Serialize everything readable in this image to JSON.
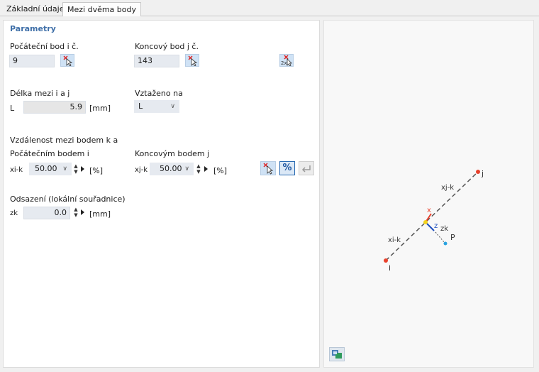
{
  "tabs": [
    {
      "label": "Základní údaje",
      "active": false
    },
    {
      "label": "Mezi dvěma body",
      "active": true
    }
  ],
  "params": {
    "section_title": "Parametry",
    "start_label": "Počáteční bod i č.",
    "start_value": "9",
    "end_label": "Koncový bod j č.",
    "end_value": "143",
    "length_label": "Délka mezi i a j",
    "length_symbol": "L",
    "length_value": "5.9",
    "length_unit": "[mm]",
    "ref_label": "Vztaženo na",
    "ref_value": "L",
    "distance_title": "Vzdálenost mezi bodem k a",
    "from_start_label": "Počátečním bodem i",
    "xik_symbol": "xi-k",
    "xik_value": "50.00",
    "xik_unit": "[%]",
    "from_end_label": "Koncovým bodem j",
    "xjk_symbol": "xj-k",
    "xjk_value": "50.00",
    "xjk_unit": "[%]",
    "offset_title": "Odsazení (lokální souřadnice)",
    "zk_symbol": "zk",
    "zk_value": "0.0",
    "zk_unit": "[mm]",
    "percent_button": "%"
  },
  "diagram": {
    "label_i": "i",
    "label_j": "j",
    "label_xik": "xi-k",
    "label_xjk": "xj-k",
    "label_x": "x",
    "label_z": "z",
    "label_zk": "zk",
    "label_p": "P",
    "colors": {
      "point": "#e8412c",
      "k_point": "#f2d21b",
      "p_point": "#2aa3e0",
      "x_axis": "#e8412c",
      "z_axis": "#1f4fbf",
      "line": "#555555"
    }
  }
}
